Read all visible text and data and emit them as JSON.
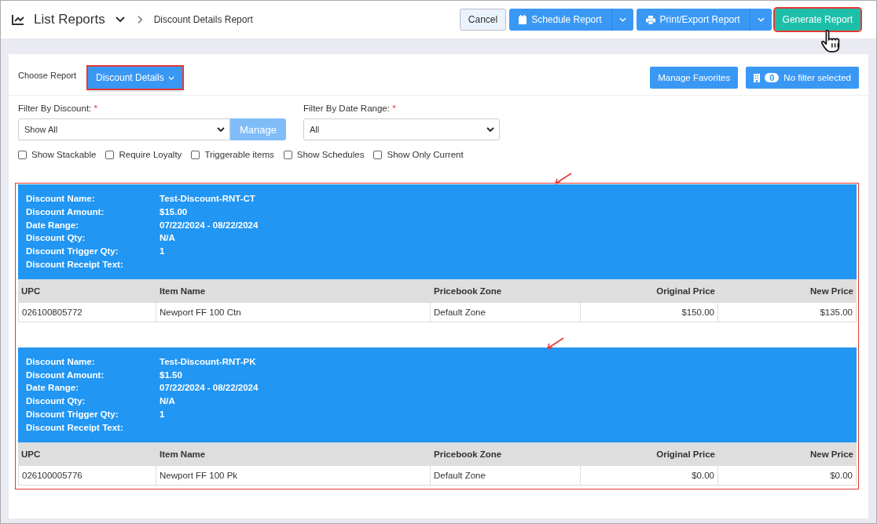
{
  "header": {
    "title": "List Reports",
    "breadcrumb": "Discount Details Report",
    "buttons": [
      {
        "kind": "cancel",
        "label": "Cancel"
      },
      {
        "kind": "schedule",
        "label": "Schedule Report"
      },
      {
        "kind": "export",
        "label": "Print/Export Report"
      },
      {
        "kind": "generate",
        "label": "Generate Report"
      }
    ]
  },
  "choose_report": {
    "label": "Choose Report",
    "value": "Discount Details"
  },
  "favorites_button": "Manage Favorites",
  "filter_status": {
    "count": "0",
    "label": "No filter selected"
  },
  "filter_discount": {
    "label": "Filter By Discount:",
    "required": "*",
    "value": "Show All",
    "button": "Manage"
  },
  "filter_date": {
    "label": "Filter By Date Range:",
    "required": "*",
    "value": "All"
  },
  "options": [
    {
      "label": "Show Stackable",
      "checked": false
    },
    {
      "label": "Require Loyalty",
      "checked": false
    },
    {
      "label": "Triggerable items",
      "checked": false
    },
    {
      "label": "Show Schedules",
      "checked": false
    },
    {
      "label": "Show Only Current",
      "checked": false
    }
  ],
  "reports": [
    {
      "fields": [
        {
          "label": "Discount Name:",
          "value": "Test-Discount-RNT-CT"
        },
        {
          "label": "Discount Amount:",
          "value": "$15.00"
        },
        {
          "label": "Date Range:",
          "value": "07/22/2024 - 08/22/2024"
        },
        {
          "label": "Discount Qty:",
          "value": "N/A"
        },
        {
          "label": "Discount Trigger Qty:",
          "value": "1"
        },
        {
          "label": "Discount Receipt Text:"
        }
      ],
      "columns": [
        "UPC",
        "Item Name",
        "Pricebook Zone",
        "Original Price",
        "New Price"
      ],
      "rows": [
        [
          "026100805772",
          "Newport FF 100 Ctn",
          "Default Zone",
          "$150.00",
          "$135.00"
        ]
      ]
    },
    {
      "fields": [
        {
          "label": "Discount Name:",
          "value": "Test-Discount-RNT-PK"
        },
        {
          "label": "Discount Amount:",
          "value": "$1.50"
        },
        {
          "label": "Date Range:",
          "value": "07/22/2024 - 08/22/2024"
        },
        {
          "label": "Discount Qty:",
          "value": "N/A"
        },
        {
          "label": "Discount Trigger Qty:",
          "value": "1"
        },
        {
          "label": "Discount Receipt Text:"
        }
      ],
      "columns": [
        "UPC",
        "Item Name",
        "Pricebook Zone",
        "Original Price",
        "New Price"
      ],
      "rows": [
        [
          "026100005776",
          "Newport FF 100 Pk",
          "Default Zone",
          "$0.00",
          "$0.00"
        ]
      ]
    }
  ]
}
